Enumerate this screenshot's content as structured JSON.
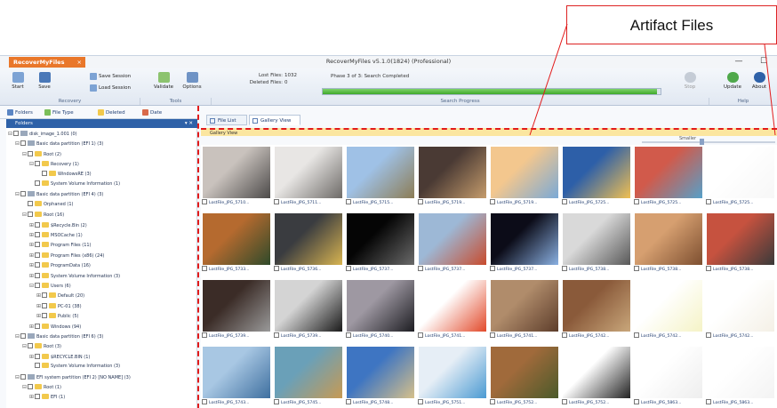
{
  "callout": {
    "label": "Artifact Files"
  },
  "titlebar": {
    "app_tab": "RecoverMyFiles",
    "app_tab_close": "×",
    "window_title": "RecoverMyFiles v5.1.0(1824) (Professional)",
    "minimize": "—",
    "restore": "☐"
  },
  "ribbon": {
    "start": "Start",
    "save": "Save",
    "save_session": "Save Session",
    "load_session": "Load Session",
    "validate": "Validate",
    "options": "Options",
    "lost_files_label": "Lost Files:",
    "lost_files_value": "1032",
    "deleted_files_label": "Deleted Files:",
    "deleted_files_value": "0",
    "phase_text": "Phase 3 of 3: Search Completed",
    "progress": 0.99,
    "stop": "Stop",
    "update": "Update",
    "about": "About",
    "group_recovery": "Recovery",
    "group_tools": "Tools",
    "group_search": "Search Progress",
    "group_help": "Help"
  },
  "left_tabs": {
    "folders": "Folders",
    "file_type": "File Type",
    "deleted": "Deleted",
    "date": "Date"
  },
  "folders_header": {
    "title": "Folders",
    "pin": "▾ ✕"
  },
  "tree": [
    {
      "exp": "⊟",
      "label": "disk_image_1.001 (0)",
      "indent": 0,
      "kind": "disk"
    },
    {
      "exp": "⊟",
      "label": "Basic data partition (EFI 1) (3)",
      "indent": 1,
      "kind": "disk"
    },
    {
      "exp": "⊟",
      "label": "Root (2)",
      "indent": 2,
      "kind": "folder"
    },
    {
      "exp": "⊟",
      "label": "Recovery (1)",
      "indent": 3,
      "kind": "folder"
    },
    {
      "exp": "",
      "label": "WindowsRE (3)",
      "indent": 4,
      "kind": "folder"
    },
    {
      "exp": "",
      "label": "System Volume Information (1)",
      "indent": 3,
      "kind": "folder"
    },
    {
      "exp": "⊟",
      "label": "Basic data partition (EFI 4) (3)",
      "indent": 1,
      "kind": "disk"
    },
    {
      "exp": "",
      "label": "Orphaned (1)",
      "indent": 2,
      "kind": "folder"
    },
    {
      "exp": "⊟",
      "label": "Root (16)",
      "indent": 2,
      "kind": "folder"
    },
    {
      "exp": "⊞",
      "label": "$Recycle.Bin (2)",
      "indent": 3,
      "kind": "folder"
    },
    {
      "exp": "⊞",
      "label": "MSOCache (1)",
      "indent": 3,
      "kind": "folder"
    },
    {
      "exp": "⊞",
      "label": "Program Files (11)",
      "indent": 3,
      "kind": "folder"
    },
    {
      "exp": "⊞",
      "label": "Program Files (x86) (24)",
      "indent": 3,
      "kind": "folder"
    },
    {
      "exp": "⊞",
      "label": "ProgramData (16)",
      "indent": 3,
      "kind": "folder"
    },
    {
      "exp": "⊞",
      "label": "System Volume Information (3)",
      "indent": 3,
      "kind": "folder"
    },
    {
      "exp": "⊟",
      "label": "Users (6)",
      "indent": 3,
      "kind": "folder"
    },
    {
      "exp": "⊞",
      "label": "Default (20)",
      "indent": 4,
      "kind": "folder"
    },
    {
      "exp": "⊞",
      "label": "PC-01 (38)",
      "indent": 4,
      "kind": "folder"
    },
    {
      "exp": "⊞",
      "label": "Public (5)",
      "indent": 4,
      "kind": "folder"
    },
    {
      "exp": "⊞",
      "label": "Windows (94)",
      "indent": 3,
      "kind": "folder"
    },
    {
      "exp": "⊟",
      "label": "Basic data partition (EFI 6) (3)",
      "indent": 1,
      "kind": "disk"
    },
    {
      "exp": "⊟",
      "label": "Root (3)",
      "indent": 2,
      "kind": "folder"
    },
    {
      "exp": "⊞",
      "label": "$RECYCLE.BIN (1)",
      "indent": 3,
      "kind": "folder"
    },
    {
      "exp": "",
      "label": "System Volume Information (3)",
      "indent": 3,
      "kind": "folder"
    },
    {
      "exp": "⊟",
      "label": "EFI system partition (EFI 2) [NO NAME] (3)",
      "indent": 1,
      "kind": "disk"
    },
    {
      "exp": "⊟",
      "label": "Root (1)",
      "indent": 2,
      "kind": "folder"
    },
    {
      "exp": "⊞",
      "label": "EFI (1)",
      "indent": 3,
      "kind": "folder"
    }
  ],
  "view_tabs": {
    "file_list": "File List",
    "gallery_view": "Gallery View"
  },
  "gallery_label": "Gallery View",
  "size_slider": {
    "label": "Smaller",
    "level": 0.45
  },
  "gallery": [
    {
      "name": "LostFile_JPG_5710...",
      "c1": "#c9c2bd",
      "c2": "#4c4a49"
    },
    {
      "name": "LostFile_JPG_5711...",
      "c1": "#e8e6e4",
      "c2": "#6d6a67"
    },
    {
      "name": "LostFile_JPG_5715...",
      "c1": "#9fc1e6",
      "c2": "#8c7c55"
    },
    {
      "name": "LostFile_JPG_5719...",
      "c1": "#4a3a34",
      "c2": "#c59c6c"
    },
    {
      "name": "LostFile_JPG_5719...",
      "c1": "#f3c78e",
      "c2": "#7aa9d6"
    },
    {
      "name": "LostFile_JPG_5725...",
      "c1": "#2d5fa8",
      "c2": "#f0c052"
    },
    {
      "name": "LostFile_JPG_5725...",
      "c1": "#d15a4b",
      "c2": "#56a0c9"
    },
    {
      "name": "LostFile_JPG_5725...",
      "c1": "#ffffff",
      "c2": "#f7f7f7"
    },
    {
      "name": "LostFile_JPG_5733...",
      "c1": "#b56a2f",
      "c2": "#2f4a2a"
    },
    {
      "name": "LostFile_JPG_5736...",
      "c1": "#3a3c40",
      "c2": "#d8b451"
    },
    {
      "name": "LostFile_JPG_5737...",
      "c1": "#050505",
      "c2": "#6a6a6a"
    },
    {
      "name": "LostFile_JPG_5737...",
      "c1": "#9db8d6",
      "c2": "#c84b2d"
    },
    {
      "name": "LostFile_JPG_5737...",
      "c1": "#0c0c18",
      "c2": "#8ab0e2"
    },
    {
      "name": "LostFile_JPG_5738...",
      "c1": "#d9d9d9",
      "c2": "#585858"
    },
    {
      "name": "LostFile_JPG_5738...",
      "c1": "#d69f70",
      "c2": "#7d4f30"
    },
    {
      "name": "LostFile_JPG_5738...",
      "c1": "#c6523f",
      "c2": "#3a3a3a"
    },
    {
      "name": "LostFile_JPG_5739...",
      "c1": "#3b2c27",
      "c2": "#9a9a9a"
    },
    {
      "name": "LostFile_JPG_5739...",
      "c1": "#d4d4d4",
      "c2": "#1a1a1a"
    },
    {
      "name": "LostFile_JPG_5740...",
      "c1": "#9e98a2",
      "c2": "#1d1d22"
    },
    {
      "name": "LostFile_JPG_5741...",
      "c1": "#ffffff",
      "c2": "#e24a2b"
    },
    {
      "name": "LostFile_JPG_5741...",
      "c1": "#b08c6b",
      "c2": "#5d3d2b"
    },
    {
      "name": "LostFile_JPG_5742...",
      "c1": "#8a5a3a",
      "c2": "#c9a77b"
    },
    {
      "name": "LostFile_JPG_5742...",
      "c1": "#ffffff",
      "c2": "#f5f3c6"
    },
    {
      "name": "LostFile_JPG_5742...",
      "c1": "#ffffff",
      "c2": "#f4f0e6"
    },
    {
      "name": "LostFile_JPG_5743...",
      "c1": "#a8c7e3",
      "c2": "#3e6f9f"
    },
    {
      "name": "LostFile_JPG_5745...",
      "c1": "#6aa0b8",
      "c2": "#c79a53"
    },
    {
      "name": "LostFile_JPG_5748...",
      "c1": "#3e75c2",
      "c2": "#d6c08a"
    },
    {
      "name": "LostFile_JPG_5751...",
      "c1": "#e6eef6",
      "c2": "#4b9ad2"
    },
    {
      "name": "LostFile_JPG_5752...",
      "c1": "#a06a3b",
      "c2": "#4a5a2a"
    },
    {
      "name": "LostFile_JPG_5752...",
      "c1": "#ffffff",
      "c2": "#222222"
    },
    {
      "name": "LostFile_JPG_5863...",
      "c1": "#ffffff",
      "c2": "#eeeeee"
    },
    {
      "name": "LostFile_JPG_5863...",
      "c1": "#ffffff",
      "c2": "#f3f3f3"
    }
  ]
}
